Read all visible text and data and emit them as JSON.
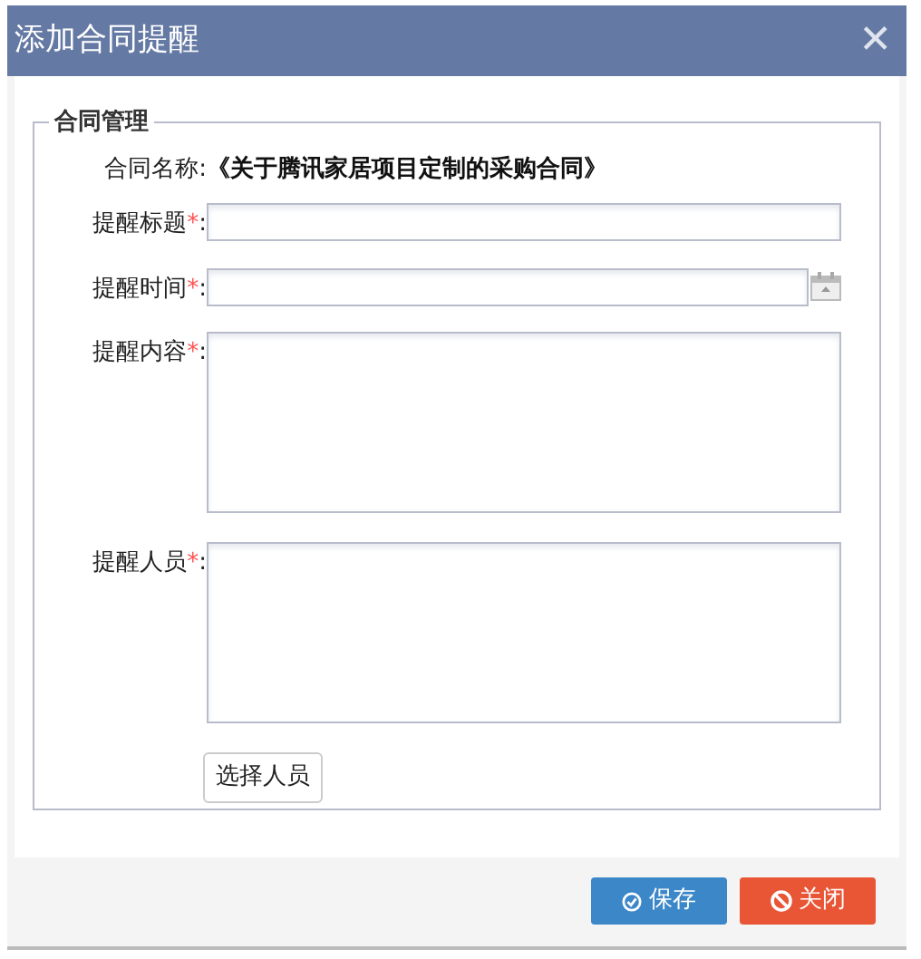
{
  "dialog": {
    "title": "添加合同提醒",
    "close": "✕"
  },
  "fieldset": {
    "legend": "合同管理",
    "fields": [
      {
        "kind": "static",
        "label": "合同名称",
        "colon": ":",
        "value": "《关于腾讯家居项目定制的采购合同》"
      },
      {
        "kind": "text",
        "label": "提醒标题",
        "required_mark": "*",
        "colon": ":"
      },
      {
        "kind": "date",
        "label": "提醒时间",
        "required_mark": "*",
        "colon": ":"
      },
      {
        "kind": "textarea",
        "label": "提醒内容",
        "required_mark": "*",
        "colon": ":"
      },
      {
        "kind": "textarea",
        "label": "提醒人员",
        "required_mark": "*",
        "colon": ":"
      }
    ],
    "pick_button": "选择人员"
  },
  "buttons": [
    {
      "kind": "save",
      "label": "保存"
    },
    {
      "kind": "close",
      "label": "关闭"
    }
  ]
}
